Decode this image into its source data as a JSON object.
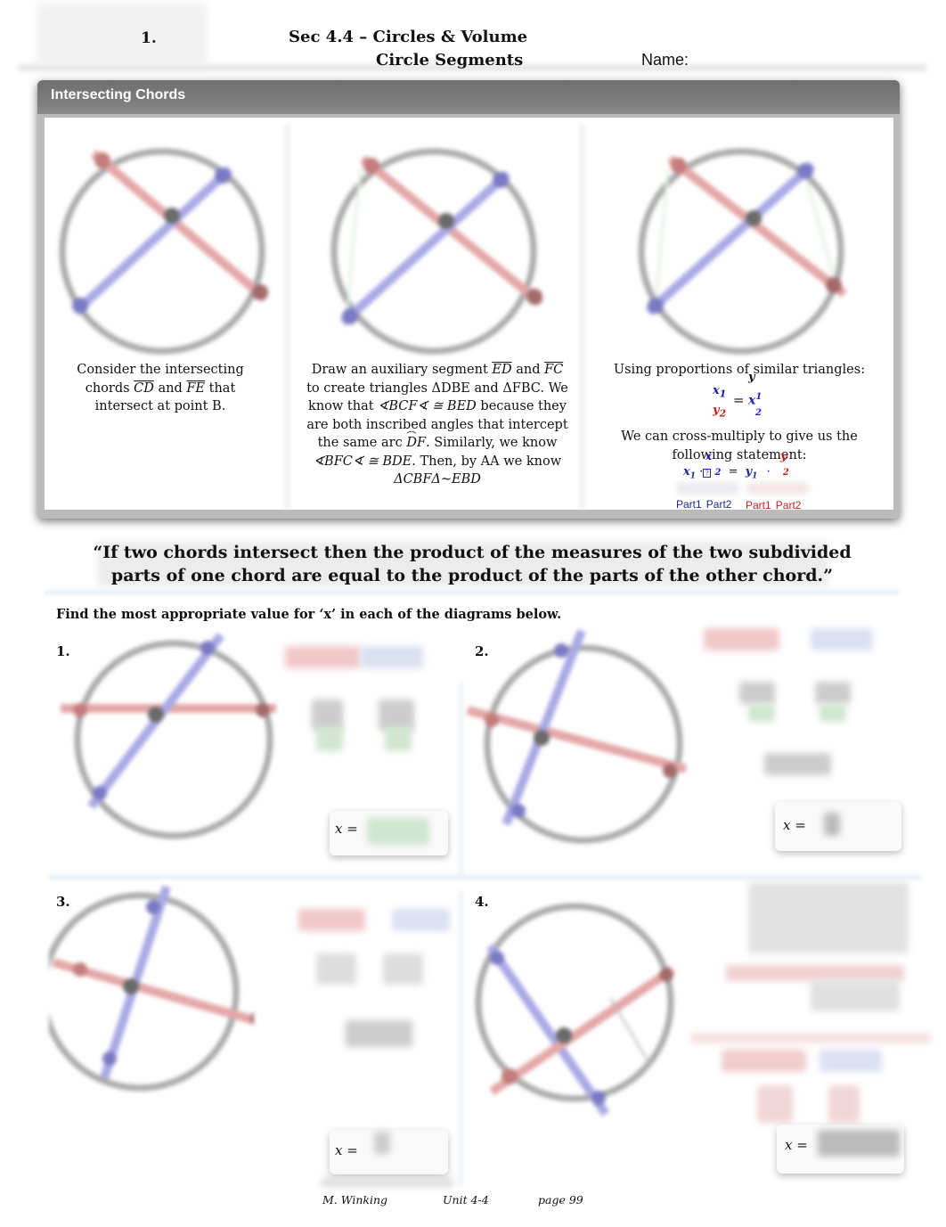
{
  "header": {
    "number": "1.",
    "title": "Sec 4.4 – Circles & Volume",
    "subtitle": "Circle Segments",
    "name_label": "Name:"
  },
  "panel": {
    "title": "Intersecting Chords",
    "col1": {
      "line1": "Consider the intersecting",
      "chords_word": "chords",
      "chord1": "CD",
      "and_word": "and",
      "chord2": "FE",
      "that_word": "that",
      "line3": "intersect at point B."
    },
    "col2": {
      "l1_pre": "Draw an auxiliary segment",
      "seg1": "ED",
      "l1_and": "and",
      "seg2": "FC",
      "l2": "to create triangles ΔDBE and ΔFBC. We",
      "l3_pre": "know that",
      "l3_math": "∢BCF∢ ≅ BED",
      "l3_post": "because they",
      "l4": "are both inscribed angles that intercept",
      "l5_pre": "the same arc",
      "l5_arc": "DF",
      "l5_post": ". Similarly, we know",
      "l6_math": "∢BFC∢ ≅ BDE",
      "l6_post": ". Then, by AA we know",
      "l7_math": "ΔCBFΔ~EBD"
    },
    "col3": {
      "line1": "Using proportions of similar triangles:",
      "prop_top_left": "x",
      "prop_top_left_sub": "1",
      "prop_bottom_left": "y",
      "prop_bottom_left_sub": "2",
      "prop_eq": "=",
      "prop_right": "x",
      "prop_right_sup": "1",
      "prop_right_sub": "2",
      "prop_y_floating": "y",
      "line2": "We can cross-multiply to give us the",
      "line3": "following statement:",
      "eq_x1": "x",
      "eq_x1_sub": "1",
      "eq_dot": "·",
      "eq_box": "?",
      "eq_sub2": "2",
      "eq_equals": "=",
      "eq_y1": "y",
      "eq_y1_sub": "1",
      "eq_dot2": "·",
      "eq_y2_sub": "2",
      "float_x": "x",
      "float_y": "y",
      "parts_blue": [
        "Part1",
        "Part2"
      ],
      "parts_red": [
        "Part1",
        "Part2"
      ]
    }
  },
  "theorem_quote": {
    "line1": "“If two chords intersect then the product of the measures of the two subdivided",
    "line2": "parts of one chord are equal to the product of the parts of the other chord.”"
  },
  "instruction": "Find the most appropriate value for ‘x’ in each of the diagrams below.",
  "problems": [
    {
      "number": "1.",
      "answer_label": "x ="
    },
    {
      "number": "2.",
      "answer_label": "x ="
    },
    {
      "number": "3.",
      "answer_label": "x ="
    },
    {
      "number": "4.",
      "answer_label": "x ="
    }
  ],
  "colors": {
    "chord_red": "#d98b8b",
    "chord_blue": "#8f8fdc",
    "circle_gray": "#a9a9a9",
    "header_bar": "#777777"
  },
  "footer": {
    "author": "M. Winking",
    "unit": "Unit 4-4",
    "page": "page  99"
  }
}
